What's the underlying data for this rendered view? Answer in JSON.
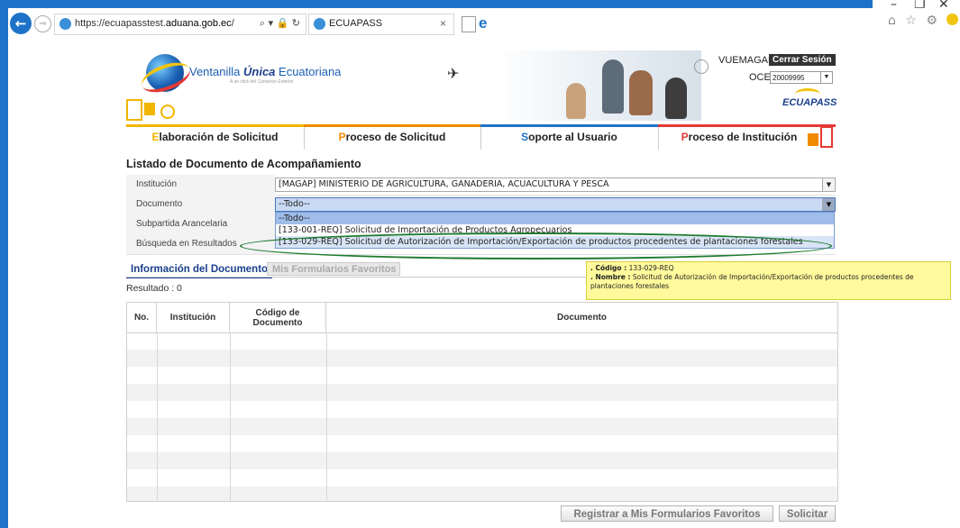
{
  "browser": {
    "url_prefix": "https://ecuapasstest.",
    "url_domain": "aduana.gob.ec",
    "url_suffix": "/",
    "address_controls": "⌕ ▾ 🔒 ↻",
    "tab_title": "ECUAPASS",
    "tab_close": "×",
    "back": "←",
    "forward": "⇒",
    "tools": "⌂ ☆ ⚙",
    "win_minimize": "–",
    "win_restore": "❐",
    "win_close": "✕"
  },
  "header": {
    "logo_text_a": "Ventanilla ",
    "logo_text_b": "Única",
    "logo_text_c": " Ecuatoriana",
    "logo_sub": "A un click del Comercio Exterior",
    "user": "VUEMAGAP",
    "logout_label": "Cerrar Sesión",
    "oce_label": "OCE",
    "oce_value": "20009995",
    "brand": "ECUAPASS"
  },
  "nav": {
    "items": [
      {
        "first": "E",
        "rest": "laboración de Solicitud",
        "color": "#f2b600"
      },
      {
        "first": "P",
        "rest": "roceso de Solicitud",
        "color": "#f08a00"
      },
      {
        "first": "S",
        "rest": "oporte al Usuario",
        "color": "#1e73c8"
      },
      {
        "first": "P",
        "rest": "roceso de Institución",
        "color": "#e53935"
      }
    ]
  },
  "page": {
    "title": "Listado de Documento de Acompañamiento"
  },
  "form": {
    "institucion_label": "Institución",
    "institucion_value": "[MAGAP] MINISTERIO DE AGRICULTURA, GANADERIA, ACUACULTURA Y PESCA",
    "documento_label": "Documento",
    "documento_value": "--Todo--",
    "subpartida_label": "Subpartida Arancelaria",
    "busqueda_label": "Búsqueda en Resultados",
    "documento_options": [
      "--Todo--",
      "[133-001-REQ] Solicitud de Importación de Productos Agropecuarios",
      "[133-029-REQ] Solicitud de Autorización de Importación/Exportación de productos procedentes de plantaciones forestales"
    ]
  },
  "tooltip": {
    "code_label": ". Código :",
    "code_value": "133-029-REQ",
    "name_label": ". Nombre :",
    "name_value": "Solicitud de Autorización de Importación/Exportación de productos procedentes de plantaciones forestales"
  },
  "tabs": {
    "info": "Información del Documento",
    "favorites": "Mis Formularios Favoritos"
  },
  "result": {
    "label": "Resultado : 0"
  },
  "table": {
    "headers": [
      "No.",
      "Institución",
      "Código de Documento",
      "Documento"
    ]
  },
  "buttons": {
    "register_favorites": "Registrar a Mis Formularios Favoritos",
    "solicitar": "Solicitar"
  }
}
